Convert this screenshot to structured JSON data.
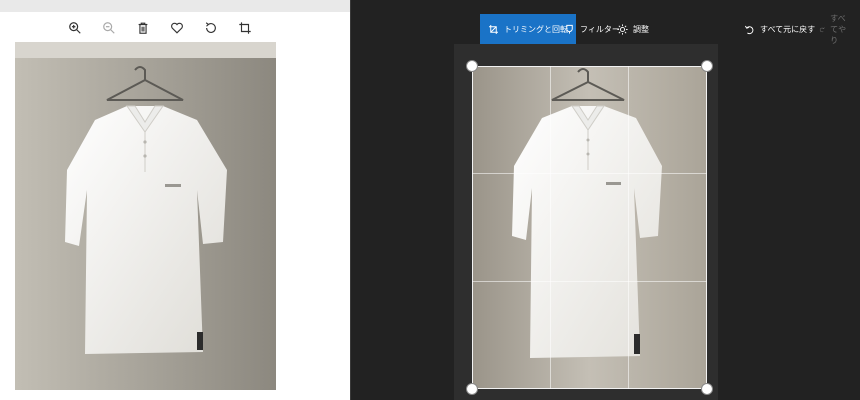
{
  "viewer": {
    "toolbar": [
      {
        "icon": "zoom-in-icon",
        "enabled": true
      },
      {
        "icon": "zoom-out-icon",
        "enabled": false
      },
      {
        "icon": "delete-icon",
        "enabled": true
      },
      {
        "icon": "favorite-icon",
        "enabled": true
      },
      {
        "icon": "rotate-icon",
        "enabled": true
      },
      {
        "icon": "crop-icon",
        "enabled": true
      }
    ]
  },
  "editor": {
    "tabs": {
      "crop_rotate": "トリミングと回転",
      "filter": "フィルター",
      "adjust": "調整"
    },
    "undo_all": "すべて元に戻す",
    "redo_all": "すべてやり",
    "active_tab": "crop_rotate",
    "colors": {
      "accent": "#1a73c7",
      "background": "#222222",
      "text": "#ffffff",
      "disabled_text": "#6f6f6f"
    }
  }
}
